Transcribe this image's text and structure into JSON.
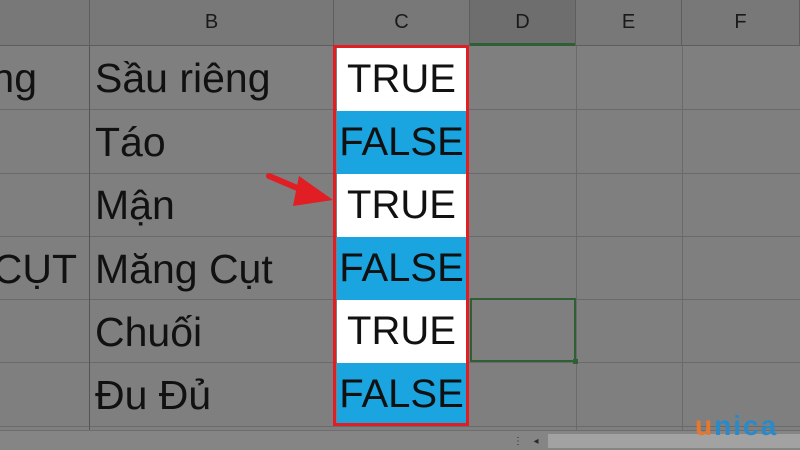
{
  "columns": [
    "B",
    "C",
    "D",
    "E",
    "F"
  ],
  "col_a_partial": [
    "ng",
    "",
    "",
    "CỤT",
    "",
    ""
  ],
  "fruits": [
    "Sầu riêng",
    "Táo",
    "Mận",
    "Măng Cụt",
    "Chuối",
    "Đu Đủ"
  ],
  "results": [
    "TRUE",
    "FALSE",
    "TRUE",
    "FALSE",
    "TRUE",
    "FALSE"
  ],
  "colors": {
    "highlight": "#1aa4e0",
    "border": "#e01e24",
    "arrow": "#e01e24"
  },
  "logo": {
    "u": "u",
    "rest": "nica"
  }
}
